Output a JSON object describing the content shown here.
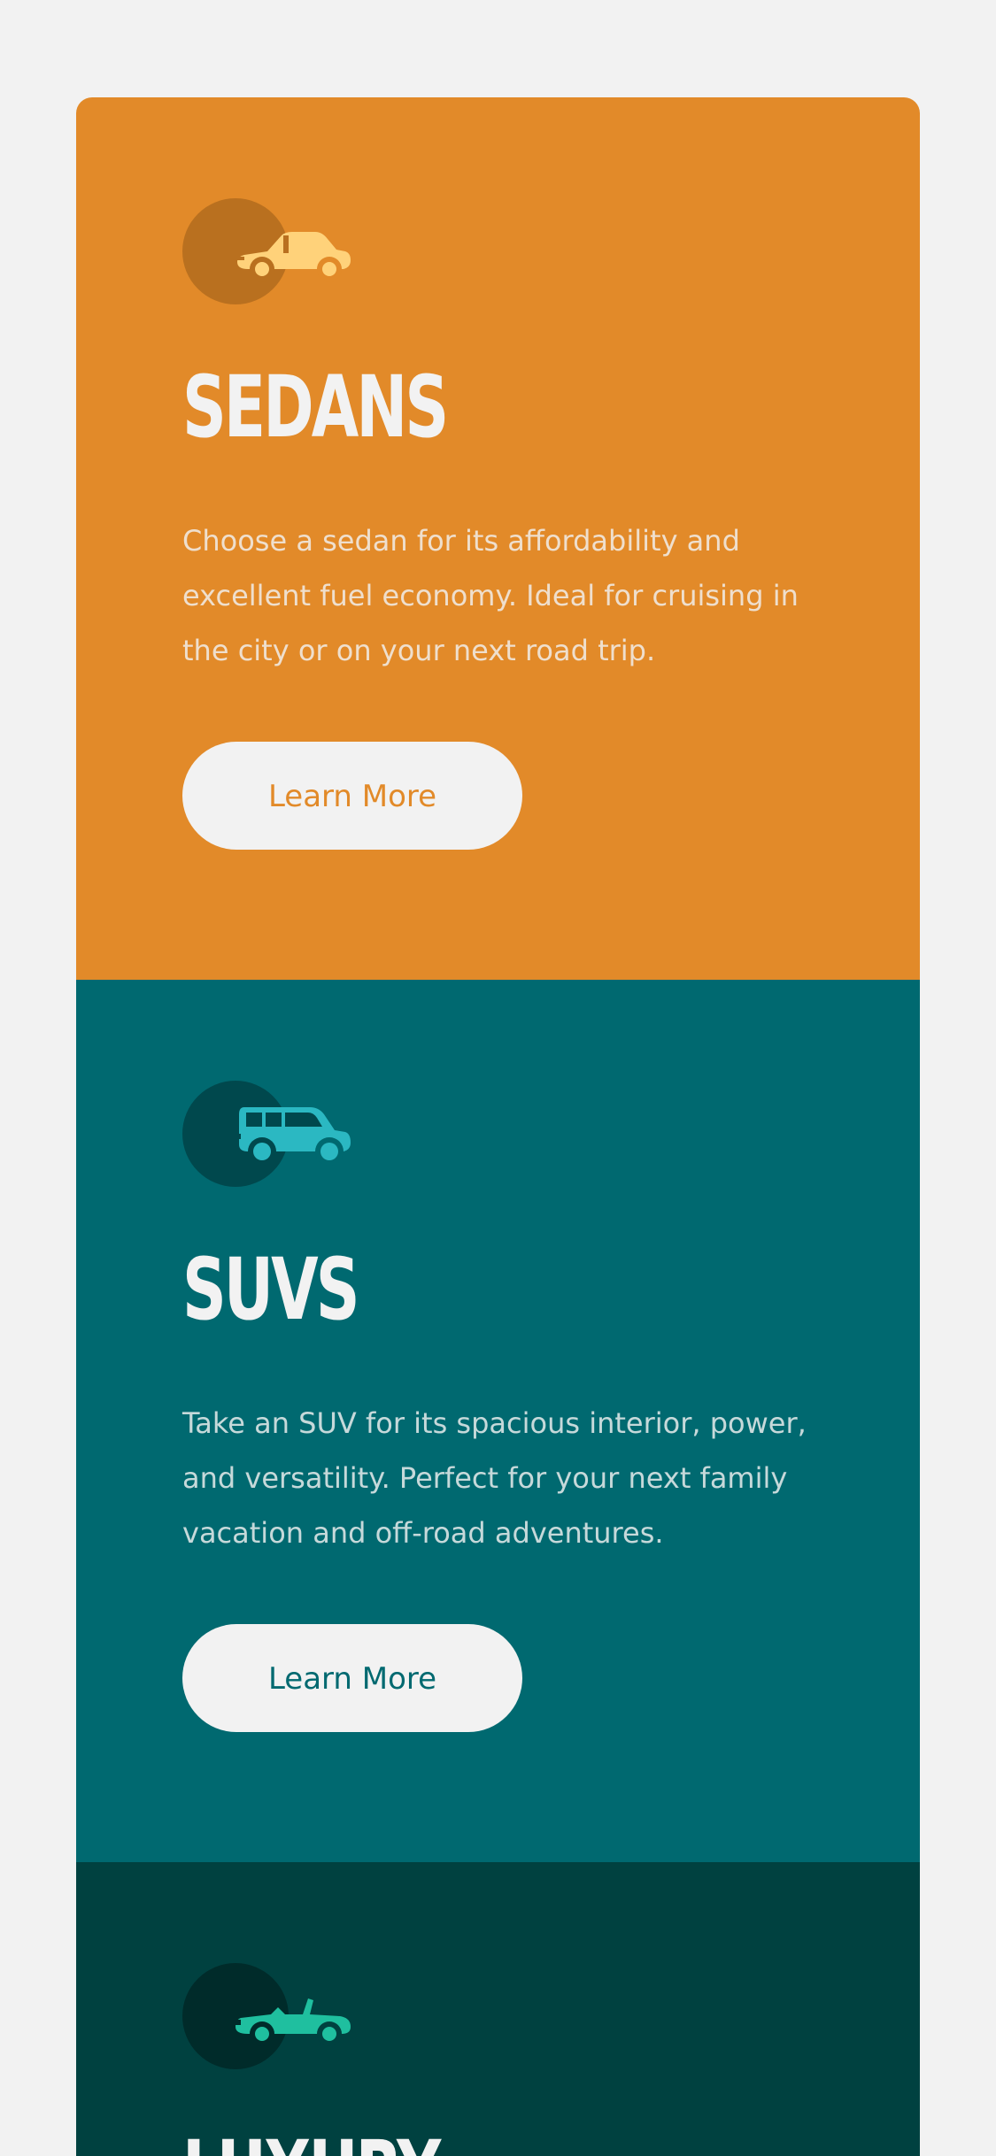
{
  "colors": {
    "background": "#f2f2f2",
    "sedans": "#e28a29",
    "suvs": "#006970",
    "luxury": "#004140",
    "text_light": "#f2f2f2"
  },
  "cards": [
    {
      "icon": "sedan-car-icon",
      "title": "Sedans",
      "description": "Choose a sedan for its affordability and excellent fuel economy. Ideal for cruising in the city or on your next road trip.",
      "button_label": "Learn More"
    },
    {
      "icon": "suv-car-icon",
      "title": "SUVs",
      "description": "Take an SUV for its spacious interior, power, and versatility. Perfect for your next family vacation and off-road adventures.",
      "button_label": "Learn More"
    },
    {
      "icon": "luxury-convertible-icon",
      "title": "Luxury"
    }
  ]
}
